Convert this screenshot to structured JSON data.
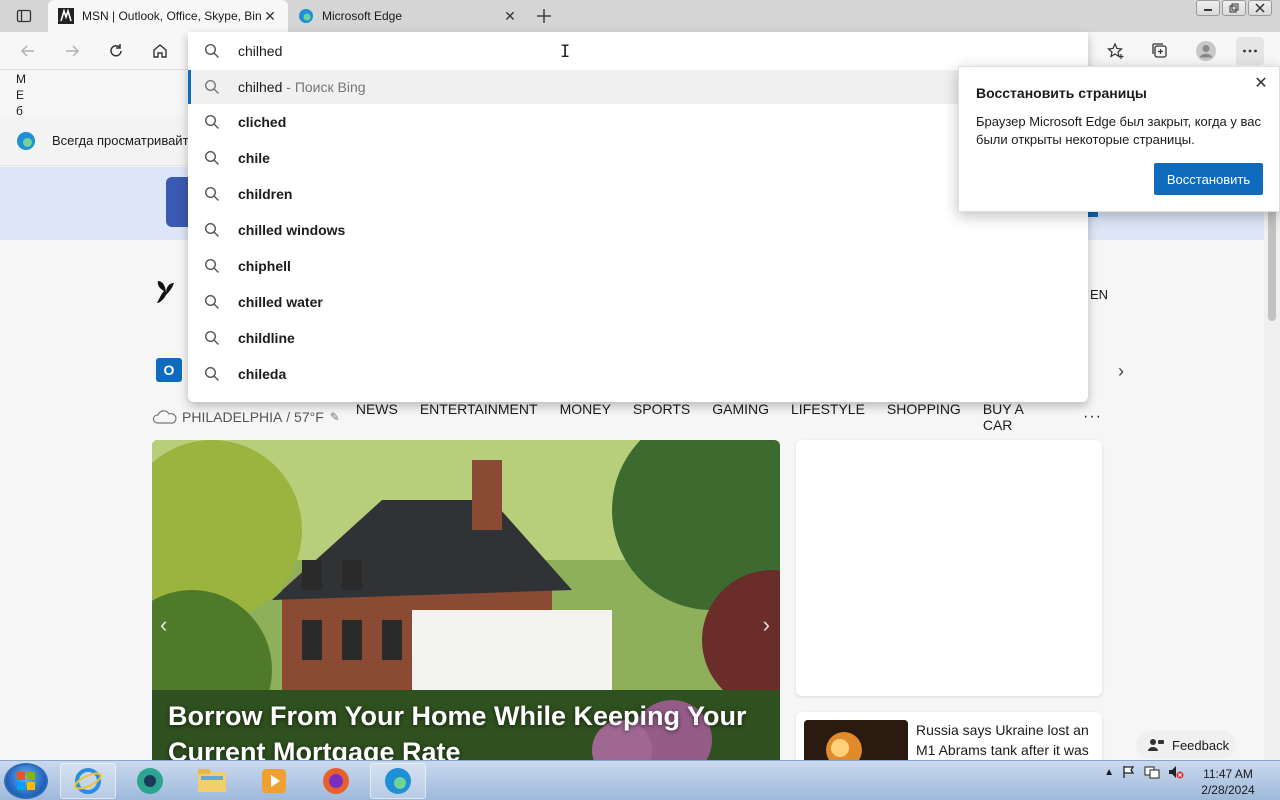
{
  "tabs": [
    {
      "title": "MSN | Outlook, Office, Skype, Bing",
      "active": true
    },
    {
      "title": "Microsoft Edge",
      "active": false
    }
  ],
  "omnibox": {
    "value": "chilhed",
    "first_suggestion": {
      "query": "chilhed",
      "suffix": " - Поиск Bing"
    },
    "suggestions": [
      "cliched",
      "chile",
      "children",
      "chilled windows",
      "chiphell",
      "chilled water",
      "childline",
      "chileda"
    ]
  },
  "page": {
    "side_letters": [
      "М",
      "Е",
      "б"
    ],
    "infobar_text": "Всегда просматривайте",
    "lang": "EN",
    "weather": {
      "city": "PHILADELPHIA",
      "temp": "57°F"
    },
    "nav": [
      "NEWS",
      "ENTERTAINMENT",
      "MONEY",
      "SPORTS",
      "GAMING",
      "LIFESTYLE",
      "SHOPPING",
      "BUY A CAR"
    ],
    "hero_title": "Borrow From Your Home While Keeping Your Current Mortgage Rate",
    "news_title": "Russia says Ukraine lost an M1 Abrams tank after it was",
    "feedback": "Feedback"
  },
  "popup": {
    "title": "Восстановить страницы",
    "body": "Браузер Microsoft Edge был закрыт, когда у вас были открыты некоторые страницы.",
    "button": "Восстановить"
  },
  "taskbar": {
    "time": "11:47 AM",
    "date": "2/28/2024"
  },
  "colors": {
    "accent": "#0f6cbd"
  }
}
